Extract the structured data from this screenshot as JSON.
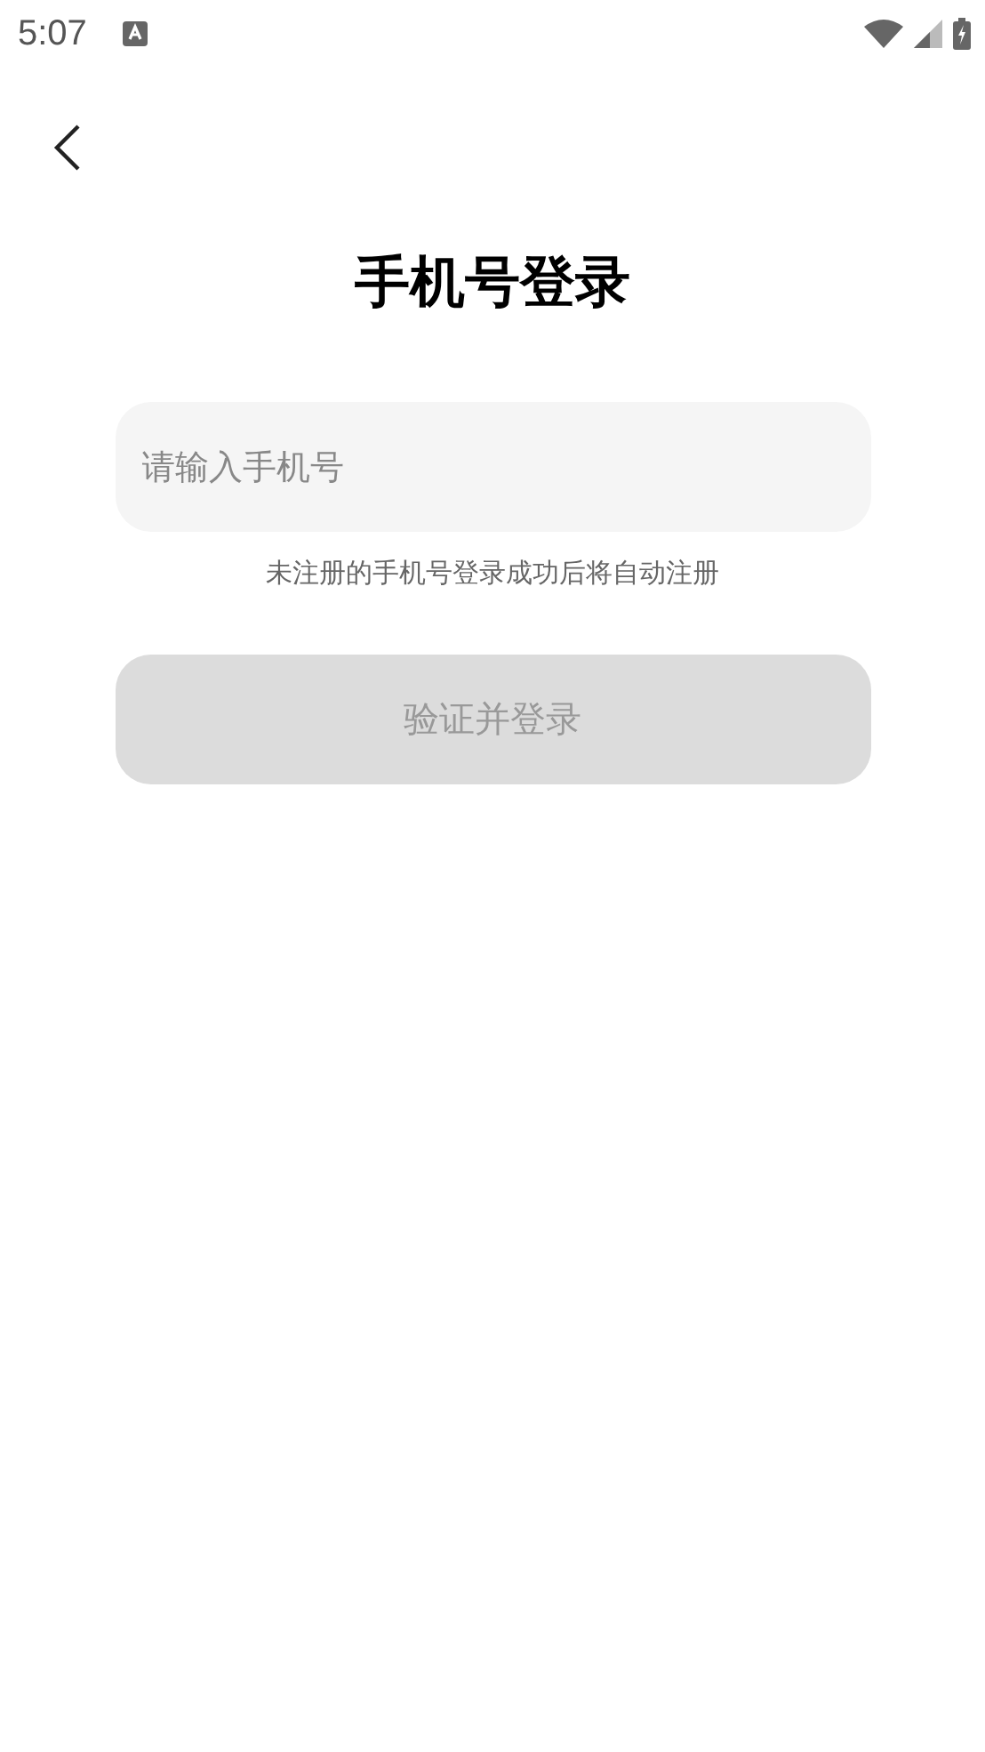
{
  "status_bar": {
    "time": "5:07"
  },
  "title": "手机号登录",
  "phone_field": {
    "placeholder": "请输入手机号"
  },
  "hint": "未注册的手机号登录成功后将自动注册",
  "submit_button": {
    "label": "验证并登录",
    "disabled": true
  }
}
